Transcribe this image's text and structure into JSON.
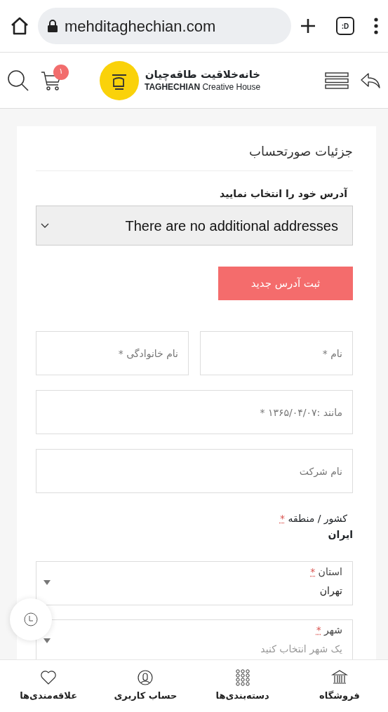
{
  "browser": {
    "url": "mehditaghechian.com",
    "tab_switcher": ":D"
  },
  "header": {
    "cart_count": "۱",
    "logo_title": "خانه‌خلاقیت طاقه‌چیان",
    "logo_subtitle_bold": "TAGHECHIAN",
    "logo_subtitle": "Creative House"
  },
  "form": {
    "title": "جزئیات صورتحساب",
    "address_label": "آدرس خود را انتخاب نمایید",
    "address_select": "There are no additional addresses",
    "new_address_button": "ثبت آدرس جدید",
    "name_fields": [
      {
        "placeholder": "نام *"
      },
      {
        "placeholder": "نام خانوادگی *"
      }
    ],
    "fields": [
      {
        "placeholder": "مانند :۱۳۶۵/۰۴/۰۷ *"
      },
      {
        "placeholder": "نام شرکت"
      }
    ],
    "country": {
      "label": "کشور / منطقه",
      "required_mark": "*",
      "value": "ایران"
    },
    "selects": [
      {
        "label": "استان",
        "required_mark": "*",
        "value": "تهران"
      },
      {
        "label": "شهر",
        "required_mark": "*",
        "placeholder": "یک شهر انتخاب کنید"
      }
    ]
  },
  "bottom_nav": [
    {
      "kind": "shop",
      "label": "فروشگاه"
    },
    {
      "kind": "categories",
      "label": "دسته‌بندی‌ها"
    },
    {
      "kind": "account",
      "label": "حساب کاربری"
    },
    {
      "kind": "wishlist",
      "label": "علاقه‌مندی‌ها"
    }
  ]
}
